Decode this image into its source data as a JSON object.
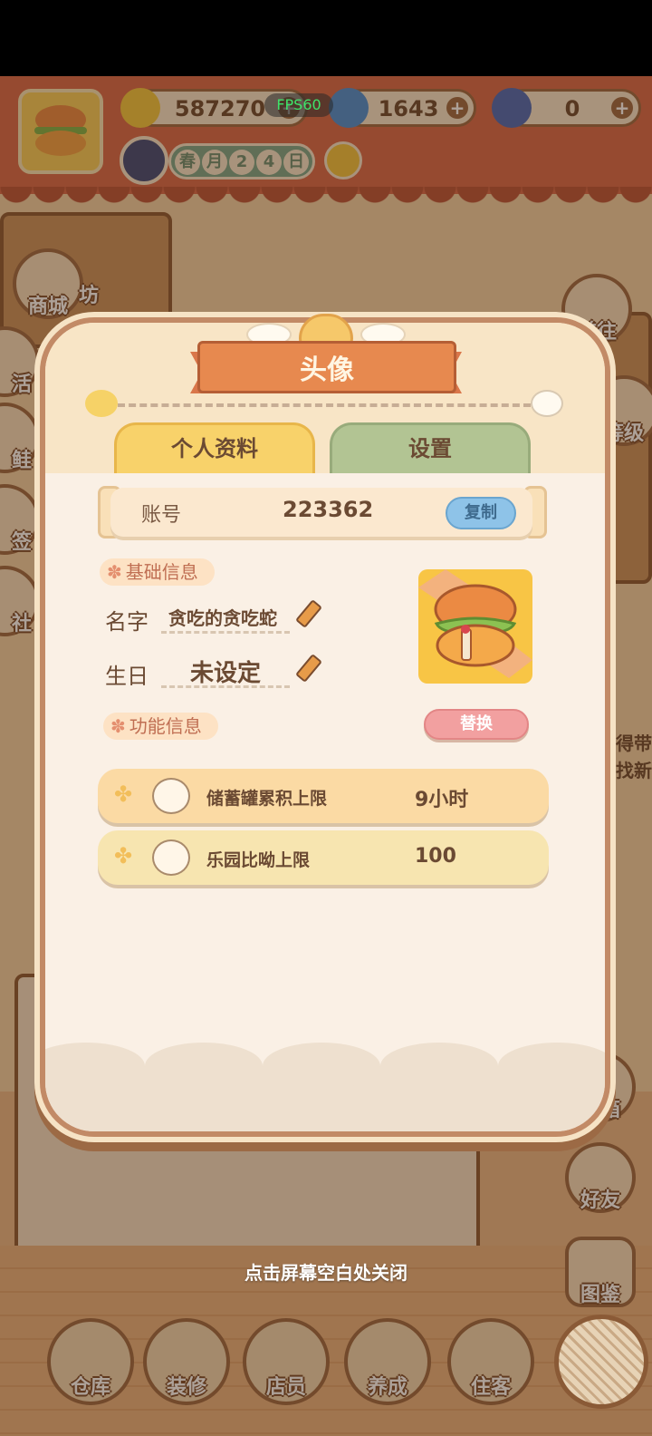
{
  "resources": {
    "bananas": "587270",
    "fire": "1643",
    "eggplant": "0"
  },
  "date": {
    "chars": [
      "春",
      "月",
      "2",
      "4",
      "日"
    ]
  },
  "fps": "FPS60",
  "side_left": {
    "shop": "商城",
    "activity": "活",
    "partial_3": "鲑",
    "partial_4": "签",
    "partial_5": "社"
  },
  "side_left_back": "坊",
  "side_right": {
    "goto": "前往",
    "level": "等级",
    "mailbox": "邮箱",
    "friends": "好友",
    "encyclopedia": "图鉴"
  },
  "right_edge_text": [
    "已得带",
    "寻找新"
  ],
  "dialog": {
    "title": "头像",
    "tabs": {
      "profile": "个人资料",
      "settings": "设置"
    },
    "account": {
      "label": "账号",
      "value": "223362",
      "copy": "复制"
    },
    "basic_section": "基础信息",
    "name": {
      "label": "名字",
      "value": "贪吃的贪吃蛇"
    },
    "birthday": {
      "label": "生日",
      "value": "未设定"
    },
    "replace": "替换",
    "function_section": "功能信息",
    "rows": [
      {
        "label": "储蓄罐累积上限",
        "value": "9小时"
      },
      {
        "label": "乐园比呦上限",
        "value": "100"
      }
    ]
  },
  "close_hint": "点击屏幕空白处关闭",
  "bottom_nav": [
    "仓库",
    "装修",
    "店员",
    "养成",
    "住客"
  ],
  "colors": {
    "topbar": "#d76a4d",
    "dialog_bg": "#fbeedc",
    "tab_active": "#f8d26a",
    "tab_inactive": "#b2c493",
    "copy_button": "#8ec3e8",
    "replace_button": "#f2a0a0"
  }
}
